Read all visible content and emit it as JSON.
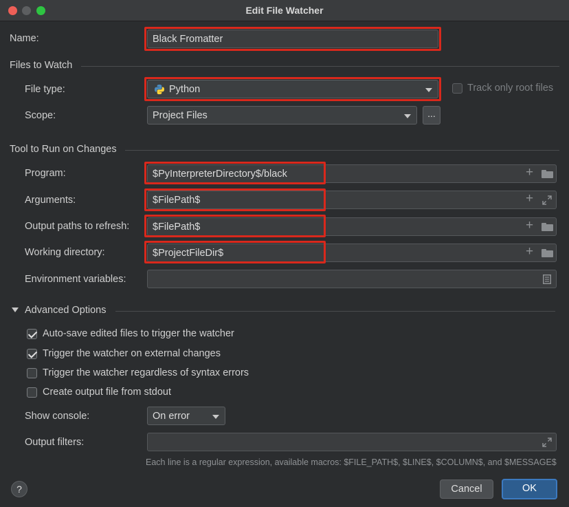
{
  "window": {
    "title": "Edit File Watcher"
  },
  "name": {
    "label": "Name:",
    "value": "Black Fromatter"
  },
  "files_to_watch": {
    "section_title": "Files to Watch",
    "file_type_label": "File type:",
    "file_type_value": "Python",
    "file_type_icon": "python-icon",
    "track_root_label": "Track only root files",
    "track_root_checked": false,
    "scope_label": "Scope:",
    "scope_value": "Project Files",
    "scope_more_label": "..."
  },
  "tool": {
    "section_title": "Tool to Run on Changes",
    "program_label": "Program:",
    "program_value": "$PyInterpreterDirectory$/black",
    "arguments_label": "Arguments:",
    "arguments_value": "$FilePath$",
    "output_paths_label": "Output paths to refresh:",
    "output_paths_value": "$FilePath$",
    "working_dir_label": "Working directory:",
    "working_dir_value": "$ProjectFileDir$",
    "env_label": "Environment variables:",
    "env_value": ""
  },
  "advanced": {
    "section_title": "Advanced Options",
    "expanded": true,
    "options": [
      {
        "label": "Auto-save edited files to trigger the watcher",
        "checked": true
      },
      {
        "label": "Trigger the watcher on external changes",
        "checked": true
      },
      {
        "label": "Trigger the watcher regardless of syntax errors",
        "checked": false
      },
      {
        "label": "Create output file from stdout",
        "checked": false
      }
    ],
    "show_console_label": "Show console:",
    "show_console_value": "On error",
    "output_filters_label": "Output filters:",
    "output_filters_value": "",
    "hint": "Each line is a regular expression, available macros: $FILE_PATH$, $LINE$, $COLUMN$, and $MESSAGE$"
  },
  "buttons": {
    "help": "?",
    "cancel": "Cancel",
    "ok": "OK"
  },
  "colors": {
    "background": "#2b2d2f",
    "highlight": "#d9281c",
    "ok_button": "#2d5d8f"
  }
}
